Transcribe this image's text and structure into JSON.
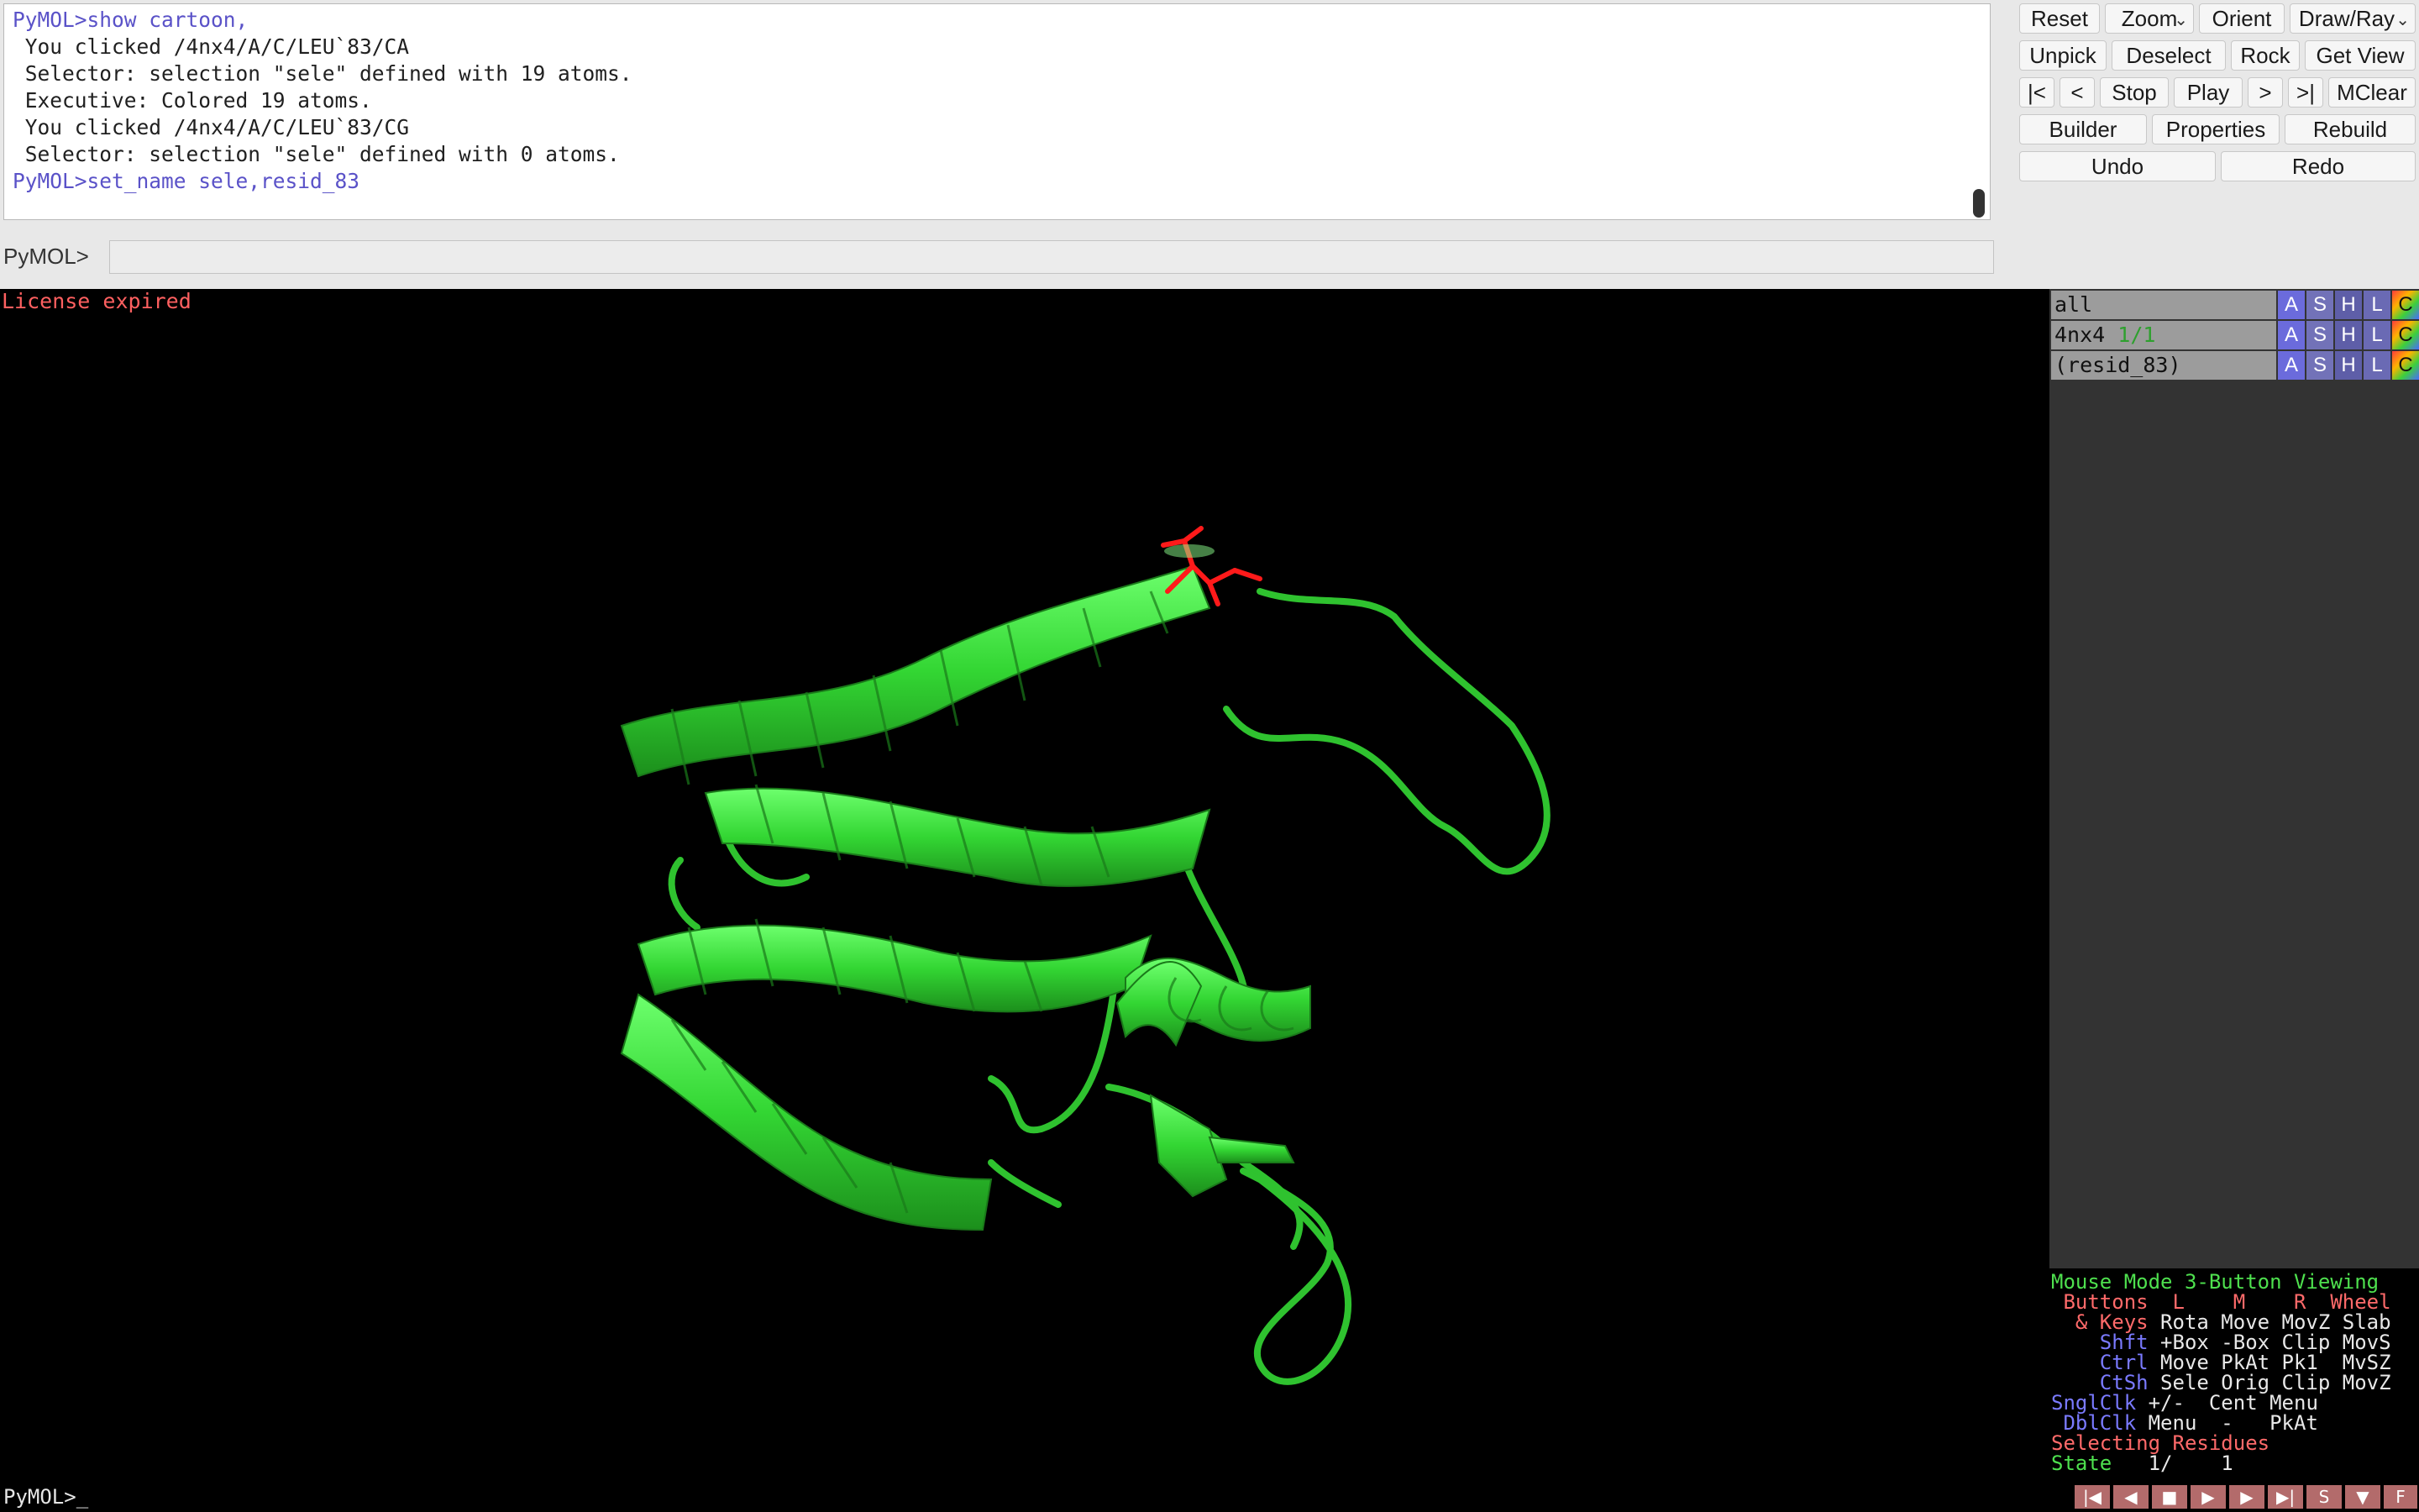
{
  "log": {
    "lines": [
      {
        "text": "PyMOL>show cartoon,",
        "kind": "cmd"
      },
      {
        "text": " You clicked /4nx4/A/C/LEU`83/CA",
        "kind": "out"
      },
      {
        "text": " Selector: selection \"sele\" defined with 19 atoms.",
        "kind": "out"
      },
      {
        "text": " Executive: Colored 19 atoms.",
        "kind": "out"
      },
      {
        "text": " You clicked /4nx4/A/C/LEU`83/CG",
        "kind": "out"
      },
      {
        "text": " Selector: selection \"sele\" defined with 0 atoms.",
        "kind": "out"
      },
      {
        "text": "PyMOL>set_name sele,resid_83",
        "kind": "cmd"
      }
    ]
  },
  "command": {
    "label": "PyMOL>",
    "value": ""
  },
  "buttons": {
    "reset": "Reset",
    "zoom": "Zoom",
    "orient": "Orient",
    "draw_ray": "Draw/Ray",
    "unpick": "Unpick",
    "deselect": "Deselect",
    "rock": "Rock",
    "get_view": "Get View",
    "first": "|<",
    "prev": "<",
    "stop": "Stop",
    "play": "Play",
    "next": ">",
    "last": ">|",
    "mclear": "MClear",
    "builder": "Builder",
    "properties": "Properties",
    "rebuild": "Rebuild",
    "undo": "Undo",
    "redo": "Redo"
  },
  "viewer": {
    "license": "License expired",
    "protein_color": "#33d633",
    "selection_color": "#ff1a1a"
  },
  "objects": [
    {
      "name": "all",
      "state": ""
    },
    {
      "name": "4nx4 ",
      "state": "1/1"
    },
    {
      "name": "(resid_83)",
      "state": ""
    }
  ],
  "object_buttons": {
    "a": "A",
    "s": "S",
    "h": "H",
    "l": "L",
    "c": "C"
  },
  "mouse_mode": {
    "title": "Mouse Mode 3-Button Viewing",
    "header": " Buttons  L    M    R  Wheel",
    "rows": [
      {
        "mod": "  & Keys",
        "vals": " Rota Move MovZ Slab"
      },
      {
        "mod": "    Shft",
        "vals": " +Box -Box Clip MovS"
      },
      {
        "mod": "    Ctrl",
        "vals": " Move PkAt Pk1  MvSZ"
      },
      {
        "mod": "    CtSh",
        "vals": " Sele Orig Clip MovZ"
      },
      {
        "mod": "SnglClk",
        "vals": " +/-  Cent Menu"
      },
      {
        "mod": " DblClk",
        "vals": " Menu  -   PkAt"
      }
    ],
    "selecting": "Selecting Residues",
    "state_label": "State",
    "state_value": "   1/    1"
  },
  "playback": [
    "|◀",
    "◀",
    "■",
    "▶",
    "▶",
    "▶|",
    "S",
    "▼",
    "F"
  ],
  "bottom_prompt": "PyMOL>_"
}
